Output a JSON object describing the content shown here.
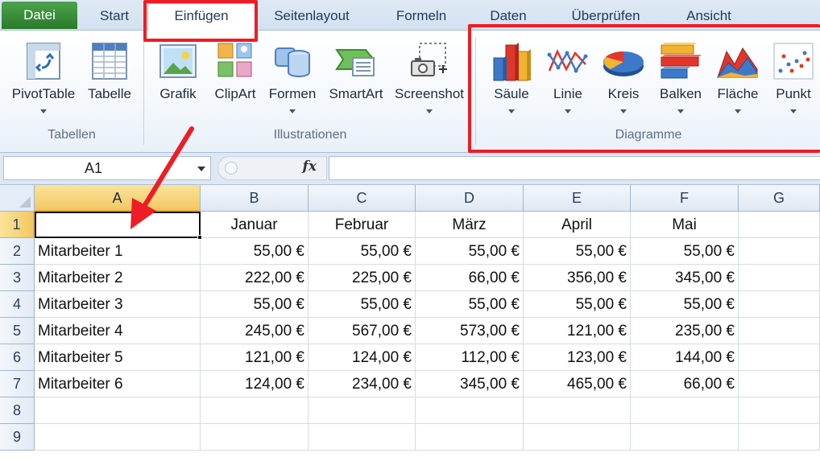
{
  "tabs": {
    "file": "Datei",
    "items": [
      "Start",
      "Einfügen",
      "Seitenlayout",
      "Formeln",
      "Daten",
      "Überprüfen",
      "Ansicht"
    ],
    "active": "Einfügen"
  },
  "ribbon": {
    "groups": {
      "tables": {
        "label": "Tabellen",
        "buttons": [
          {
            "label": "PivotTable",
            "icon": "pivottable-icon"
          },
          {
            "label": "Tabelle",
            "icon": "table-icon"
          }
        ]
      },
      "illustrations": {
        "label": "Illustrationen",
        "buttons": [
          {
            "label": "Grafik",
            "icon": "picture-icon"
          },
          {
            "label": "ClipArt",
            "icon": "clipart-icon"
          },
          {
            "label": "Formen",
            "icon": "shapes-icon"
          },
          {
            "label": "SmartArt",
            "icon": "smartart-icon"
          },
          {
            "label": "Screenshot",
            "icon": "screenshot-icon"
          }
        ]
      },
      "charts": {
        "label": "Diagramme",
        "buttons": [
          {
            "label": "Säule",
            "icon": "column-chart-icon"
          },
          {
            "label": "Linie",
            "icon": "line-chart-icon"
          },
          {
            "label": "Kreis",
            "icon": "pie-chart-icon"
          },
          {
            "label": "Balken",
            "icon": "bar-chart-icon"
          },
          {
            "label": "Fläche",
            "icon": "area-chart-icon"
          },
          {
            "label": "Punkt",
            "icon": "scatter-chart-icon"
          }
        ]
      }
    }
  },
  "formula_bar": {
    "name_box": "A1",
    "fx_label": "fx",
    "value": ""
  },
  "sheet": {
    "columns": [
      "A",
      "B",
      "C",
      "D",
      "E",
      "F",
      "G"
    ],
    "rows": [
      "1",
      "2",
      "3",
      "4",
      "5",
      "6",
      "7",
      "8",
      "9"
    ],
    "header_row": [
      "",
      "Januar",
      "Februar",
      "März",
      "April",
      "Mai"
    ],
    "data": [
      [
        "Mitarbeiter 1",
        "55,00 €",
        "55,00 €",
        "55,00 €",
        "55,00 €",
        "55,00 €"
      ],
      [
        "Mitarbeiter 2",
        "222,00 €",
        "225,00 €",
        "66,00 €",
        "356,00 €",
        "345,00 €"
      ],
      [
        "Mitarbeiter 3",
        "55,00 €",
        "55,00 €",
        "55,00 €",
        "55,00 €",
        "55,00 €"
      ],
      [
        "Mitarbeiter 4",
        "245,00 €",
        "567,00 €",
        "573,00 €",
        "121,00 €",
        "235,00 €"
      ],
      [
        "Mitarbeiter 5",
        "121,00 €",
        "124,00 €",
        "112,00 €",
        "123,00 €",
        "144,00 €"
      ],
      [
        "Mitarbeiter 6",
        "124,00 €",
        "234,00 €",
        "345,00 €",
        "465,00 €",
        "66,00 €"
      ]
    ],
    "active_cell": "A1"
  },
  "colors": {
    "highlight": "#ee1c24",
    "file_tab": "#2a7a2b",
    "selected_header": "#f2c862"
  }
}
